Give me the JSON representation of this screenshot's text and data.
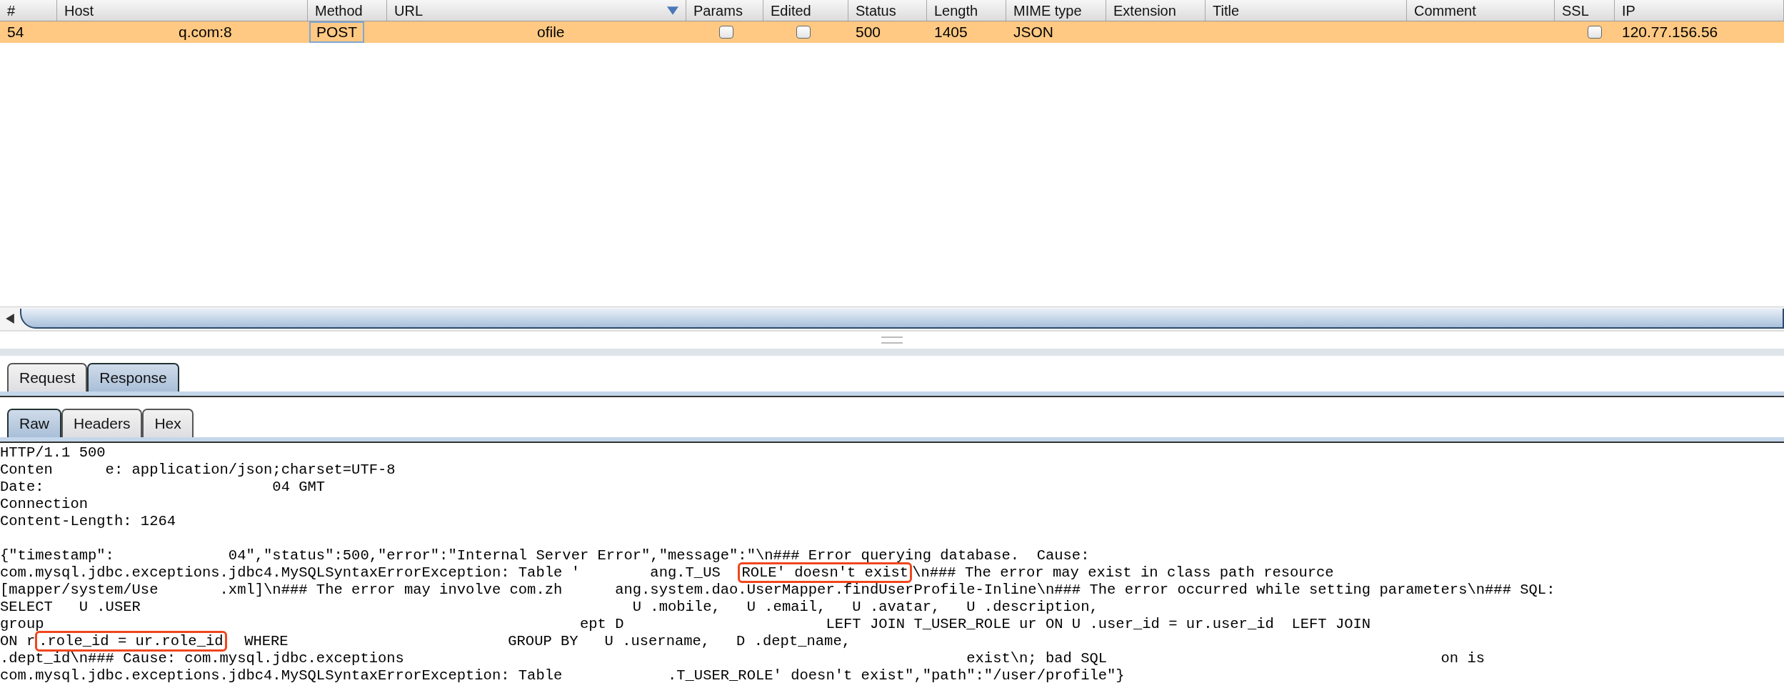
{
  "table": {
    "columns": [
      {
        "label": "#",
        "sorted": false
      },
      {
        "label": "Host",
        "sorted": false
      },
      {
        "label": "Method",
        "sorted": false
      },
      {
        "label": "URL",
        "sorted": true
      },
      {
        "label": "Params",
        "sorted": false
      },
      {
        "label": "Edited",
        "sorted": false
      },
      {
        "label": "Status",
        "sorted": false
      },
      {
        "label": "Length",
        "sorted": false
      },
      {
        "label": "MIME type",
        "sorted": false
      },
      {
        "label": "Extension",
        "sorted": false
      },
      {
        "label": "Title",
        "sorted": false
      },
      {
        "label": "Comment",
        "sorted": false
      },
      {
        "label": "SSL",
        "sorted": false
      },
      {
        "label": "IP",
        "sorted": false
      }
    ],
    "rows": [
      {
        "selected": true,
        "cells": [
          {
            "kind": "text",
            "text": "54",
            "focused": false
          },
          {
            "kind": "text",
            "text": "q.com:8",
            "focused": false
          },
          {
            "kind": "text",
            "text": "POST",
            "focused": true
          },
          {
            "kind": "text",
            "text": "ofile",
            "focused": false
          },
          {
            "kind": "checkbox",
            "checked": false
          },
          {
            "kind": "checkbox",
            "checked": false
          },
          {
            "kind": "text",
            "text": "500",
            "focused": false
          },
          {
            "kind": "text",
            "text": "1405",
            "focused": false
          },
          {
            "kind": "text",
            "text": "JSON",
            "focused": false
          },
          {
            "kind": "empty"
          },
          {
            "kind": "empty"
          },
          {
            "kind": "empty"
          },
          {
            "kind": "checkbox",
            "checked": false
          },
          {
            "kind": "text",
            "text": "120.77.156.56",
            "focused": false
          }
        ]
      }
    ]
  },
  "message_tabs": [
    {
      "label": "Request",
      "selected": false
    },
    {
      "label": "Response",
      "selected": true
    }
  ],
  "view_tabs": [
    {
      "label": "Raw",
      "selected": true
    },
    {
      "label": "Headers",
      "selected": false
    },
    {
      "label": "Hex",
      "selected": false
    }
  ],
  "response": {
    "lines": [
      {
        "kind": "text",
        "segments": [
          {
            "text": "HTTP/1.1 500",
            "highlighted": false
          }
        ]
      },
      {
        "kind": "text",
        "segments": [
          {
            "text": "Conten      e: application/json;charset=UTF-8",
            "highlighted": false
          }
        ]
      },
      {
        "kind": "text",
        "segments": [
          {
            "text": "Date:                          04 GMT",
            "highlighted": false
          }
        ]
      },
      {
        "kind": "text",
        "segments": [
          {
            "text": "Connection",
            "highlighted": false
          }
        ]
      },
      {
        "kind": "text",
        "segments": [
          {
            "text": "Content-Length: 1264",
            "highlighted": false
          }
        ]
      },
      {
        "kind": "blank"
      },
      {
        "kind": "text",
        "segments": [
          {
            "text": "{\"timestamp\":             04\",\"status\":500,\"error\":\"Internal Server Error\",\"message\":\"\\n### Error querying database.  Cause:",
            "highlighted": false
          }
        ]
      },
      {
        "kind": "text",
        "segments": [
          {
            "text": "com.mysql.jdbc.exceptions.jdbc4.MySQLSyntaxErrorException: Table '        ang.T_US  ",
            "highlighted": false
          },
          {
            "text": "ROLE' doesn't exist",
            "highlighted": true
          },
          {
            "text": "\\n### The error may exist in class path resource",
            "highlighted": false
          }
        ]
      },
      {
        "kind": "text",
        "segments": [
          {
            "text": "[mapper/system/Use       .xml]\\n### The error may involve com.zh      ang.system.dao.UserMapper.findUserProfile-Inline\\n### The error occurred while setting parameters\\n### SQL:",
            "highlighted": false
          }
        ]
      },
      {
        "kind": "text",
        "segments": [
          {
            "text": "SELECT   U .USER                                                        U .mobile,   U .email,   U .avatar,   U .description,",
            "highlighted": false
          }
        ]
      },
      {
        "kind": "text",
        "segments": [
          {
            "text": "group                                                             ept D                       LEFT JOIN T_USER_ROLE ur ON U .user_id = ur.user_id  LEFT JOIN",
            "highlighted": false
          }
        ]
      },
      {
        "kind": "text",
        "segments": [
          {
            "text": "ON r",
            "highlighted": false
          },
          {
            "text": ".role_id = ur.role_id",
            "highlighted": true
          },
          {
            "text": "  WHERE                         GROUP BY   U .username,   D .dept_name,",
            "highlighted": false
          }
        ]
      },
      {
        "kind": "text",
        "segments": [
          {
            "text": ".dept_id\\n### Cause: com.mysql.jdbc.exceptions                                                                exist\\n; bad SQL                                      on is",
            "highlighted": false
          }
        ]
      },
      {
        "kind": "text",
        "segments": [
          {
            "text": "com.mysql.jdbc.exceptions.jdbc4.MySQLSyntaxErrorException: Table            .T_USER_ROLE' doesn't exist\",\"path\":\"/user/profile\"}",
            "highlighted": false
          }
        ]
      }
    ]
  }
}
